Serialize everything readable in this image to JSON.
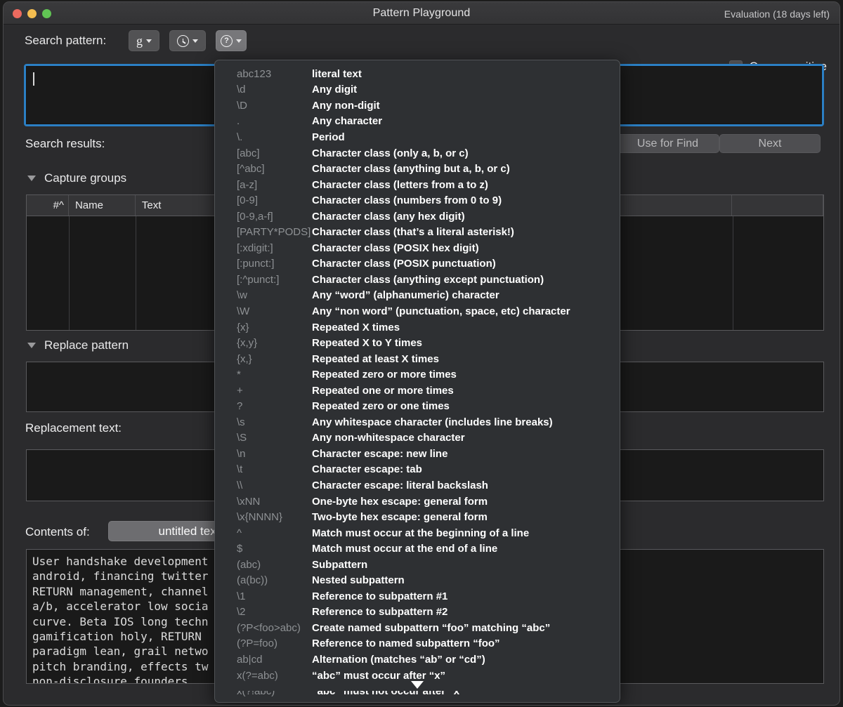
{
  "window": {
    "title": "Pattern Playground",
    "evaluation": "Evaluation (18 days left)",
    "accent_blue": "#2b7fc4",
    "traffic_lights": {
      "close": "#ec6a5f",
      "minimize": "#f4bd50",
      "zoom": "#61c454"
    }
  },
  "toolbar": {
    "search_pattern_label": "Search pattern:",
    "flavor_button": "g",
    "history_button_icon": "clock-icon",
    "help_button_icon": "question-mark-icon",
    "case_sensitive_label": "Case sensitive",
    "case_sensitive_checked": false
  },
  "search": {
    "pattern_value": "",
    "placeholder": ""
  },
  "results": {
    "label": "Search results:",
    "use_for_find_label": "Use for Find",
    "next_label": "Next"
  },
  "capture_groups": {
    "section_label": "Capture groups",
    "expanded": true,
    "columns": [
      "#^",
      "Name",
      "Text",
      ""
    ],
    "rows": []
  },
  "replace": {
    "section_label": "Replace pattern",
    "expanded": true,
    "pattern_value": "",
    "replacement_text_label": "Replacement text:",
    "replacement_value": ""
  },
  "contents": {
    "label": "Contents of:",
    "source": "untitled text",
    "body": "User handshake development\nandroid, financing twitter\nRETURN management, channel\na/b, accelerator low socia\ncurve. Beta IOS long techn\ngamification holy, RETURN\nparadigm lean, grail netwo\npitch branding, effects tw\nnon-disclosure founders."
  },
  "help_popover": {
    "visible": true,
    "scroll_arrow": "scroll-down-arrow",
    "rows": [
      {
        "syntax": "abc123",
        "desc": "literal text"
      },
      {
        "syntax": "\\d",
        "desc": "Any digit"
      },
      {
        "syntax": "\\D",
        "desc": "Any non-digit"
      },
      {
        "syntax": ".",
        "desc": "Any character"
      },
      {
        "syntax": "\\.",
        "desc": "Period"
      },
      {
        "syntax": "[abc]",
        "desc": "Character class (only a, b, or c)"
      },
      {
        "syntax": "[^abc]",
        "desc": "Character class (anything but a, b, or c)"
      },
      {
        "syntax": "[a-z]",
        "desc": "Character class (letters from a to z)"
      },
      {
        "syntax": "[0-9]",
        "desc": "Character class (numbers from 0 to 9)"
      },
      {
        "syntax": "[0-9,a-f]",
        "desc": "Character class (any hex digit)"
      },
      {
        "syntax": "[PARTY*PODS]",
        "desc": "Character class (that’s a literal asterisk!)"
      },
      {
        "syntax": "[:xdigit:]",
        "desc": "Character class (POSIX hex digit)"
      },
      {
        "syntax": "[:punct:]",
        "desc": "Character class (POSIX punctuation)"
      },
      {
        "syntax": "[:^punct:]",
        "desc": "Character class (anything except punctuation)"
      },
      {
        "syntax": "\\w",
        "desc": "Any “word” (alphanumeric) character"
      },
      {
        "syntax": "\\W",
        "desc": "Any “non word” (punctuation, space, etc) character"
      },
      {
        "syntax": "{x}",
        "desc": "Repeated X times"
      },
      {
        "syntax": "{x,y}",
        "desc": "Repeated X to Y times"
      },
      {
        "syntax": "{x,}",
        "desc": "Repeated at least X times"
      },
      {
        "syntax": "*",
        "desc": "Repeated zero or more times"
      },
      {
        "syntax": "+",
        "desc": "Repeated one or more times"
      },
      {
        "syntax": "?",
        "desc": "Repeated zero or one times"
      },
      {
        "syntax": "\\s",
        "desc": "Any whitespace character (includes line breaks)"
      },
      {
        "syntax": "\\S",
        "desc": "Any non-whitespace character"
      },
      {
        "syntax": "\\n",
        "desc": "Character escape: new line"
      },
      {
        "syntax": "\\t",
        "desc": "Character escape: tab"
      },
      {
        "syntax": "\\\\",
        "desc": "Character escape: literal backslash"
      },
      {
        "syntax": "\\xNN",
        "desc": "One-byte hex escape: general form"
      },
      {
        "syntax": "\\x{NNNN}",
        "desc": "Two-byte hex escape: general form"
      },
      {
        "syntax": "^",
        "desc": "Match must occur at the beginning of a line"
      },
      {
        "syntax": "$",
        "desc": "Match must occur at the end of a line"
      },
      {
        "syntax": "(abc)",
        "desc": "Subpattern"
      },
      {
        "syntax": "(a(bc))",
        "desc": "Nested subpattern"
      },
      {
        "syntax": "\\1",
        "desc": "Reference to subpattern #1"
      },
      {
        "syntax": "\\2",
        "desc": "Reference to subpattern #2"
      },
      {
        "syntax": "(?P<foo>abc)",
        "desc": "Create named subpattern “foo” matching “abc”"
      },
      {
        "syntax": "(?P=foo)",
        "desc": "Reference to named subpattern “foo”"
      },
      {
        "syntax": "ab|cd",
        "desc": "Alternation (matches “ab” or “cd”)"
      },
      {
        "syntax": "x(?=abc)",
        "desc": "“abc” must occur after “x”"
      },
      {
        "syntax": "x(?!abc)",
        "desc": "“abc” must not occur after “x”"
      }
    ]
  }
}
